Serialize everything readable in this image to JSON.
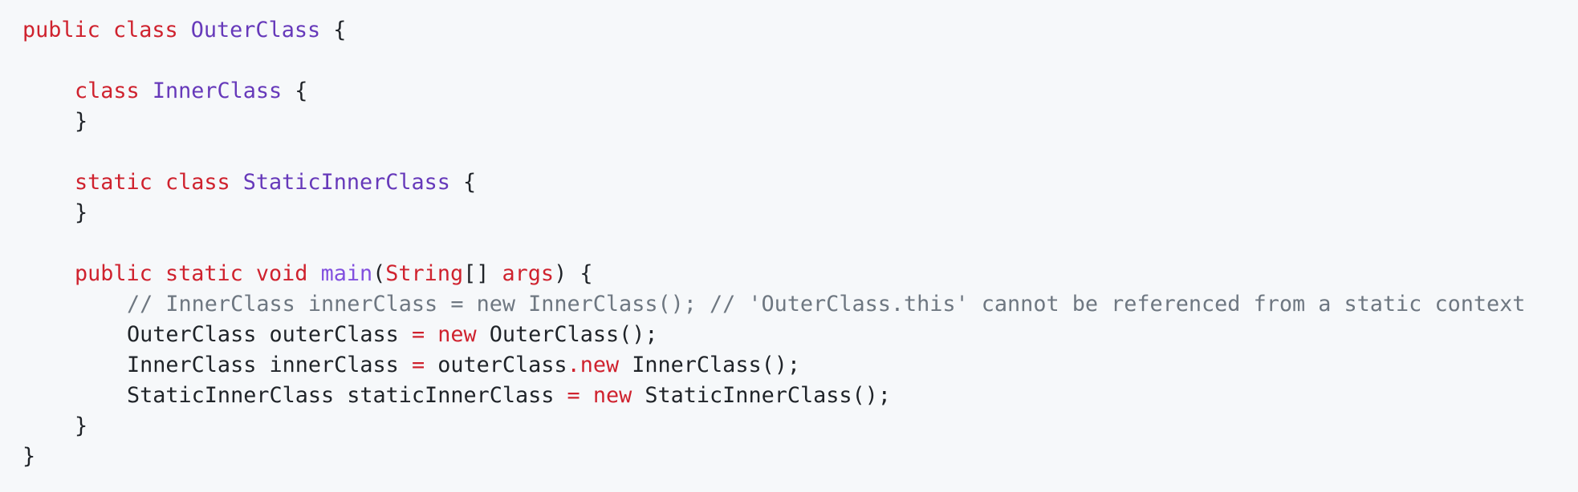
{
  "colors": {
    "background": "#f6f8fa",
    "keyword": "#cf222e",
    "type_name": "#6639ba",
    "function_name": "#8250df",
    "text": "#1f2328",
    "comment": "#6e7781"
  },
  "code": {
    "line1": {
      "kw1": "public",
      "kw2": "class",
      "name": "OuterClass",
      "brace": "{"
    },
    "line3": {
      "kw1": "class",
      "name": "InnerClass",
      "brace": "{"
    },
    "line4": {
      "brace": "}"
    },
    "line6": {
      "kw1": "static",
      "kw2": "class",
      "name": "StaticInnerClass",
      "brace": "{"
    },
    "line7": {
      "brace": "}"
    },
    "line9": {
      "kw1": "public",
      "kw2": "static",
      "kw3": "void",
      "method": "main",
      "paren_open": "(",
      "param_type": "String",
      "brackets": "[]",
      "param_name": "args",
      "paren_close": ")",
      "brace": "{"
    },
    "line10": {
      "comment": "// InnerClass innerClass = new InnerClass(); // 'OuterClass.this' cannot be referenced from a static context"
    },
    "line11": {
      "decl": "OuterClass outerClass",
      "eq": "=",
      "kw": "new",
      "rest": "OuterClass();"
    },
    "line12": {
      "decl": "InnerClass innerClass",
      "eq": "=",
      "target": "outerClass",
      "dot": ".",
      "kw": "new",
      "rest": "InnerClass();"
    },
    "line13": {
      "decl": "StaticInnerClass staticInnerClass",
      "eq": "=",
      "kw": "new",
      "rest": "StaticInnerClass();"
    },
    "line14": {
      "brace": "}"
    },
    "line15": {
      "brace": "}"
    }
  }
}
